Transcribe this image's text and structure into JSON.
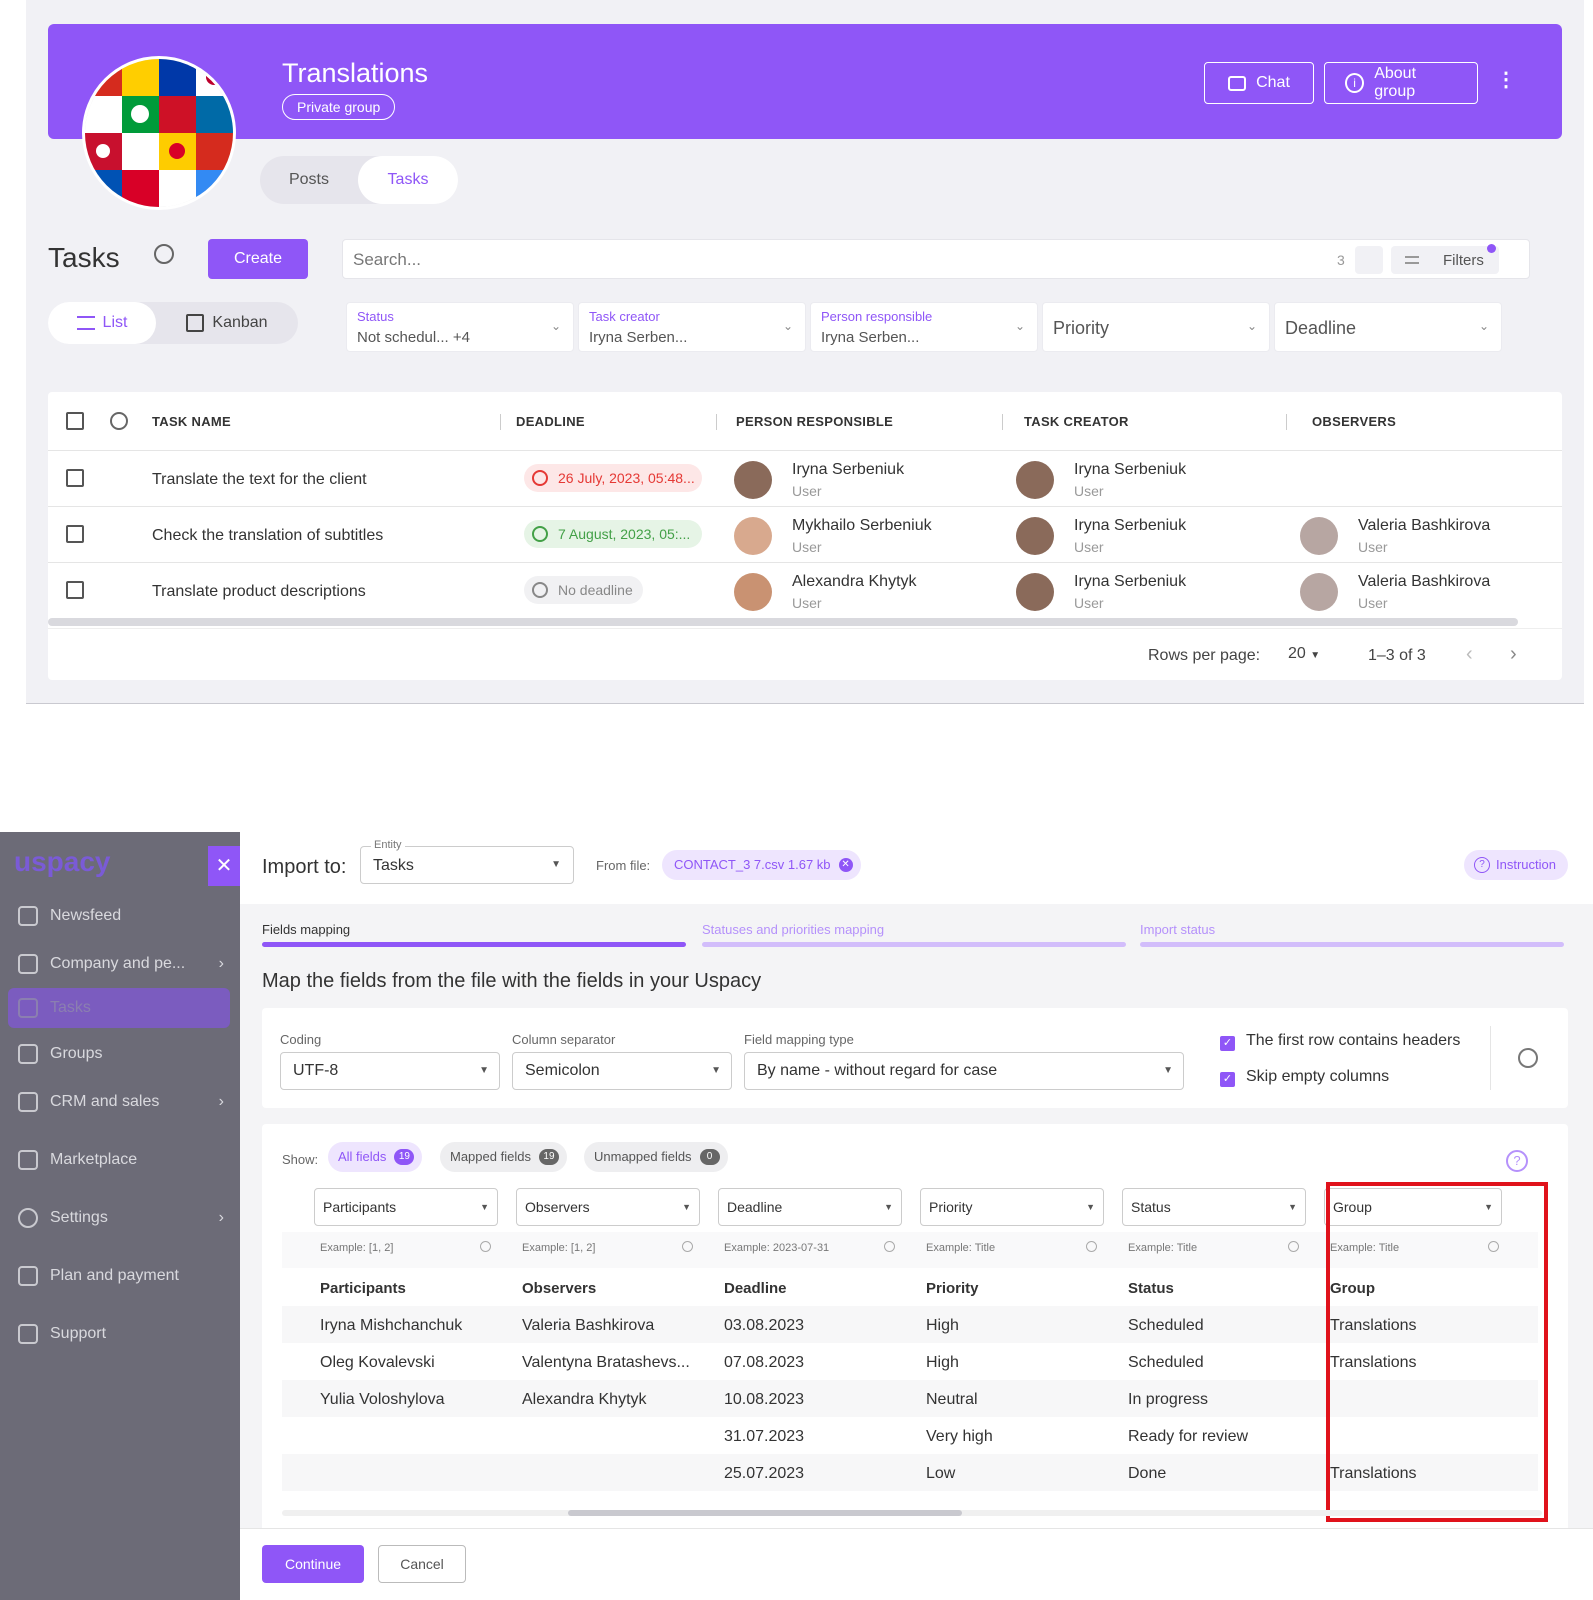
{
  "group": {
    "title": "Translations",
    "badge": "Private group",
    "chat_label": "Chat",
    "about_label": "About group",
    "tabs": [
      {
        "label": "Posts"
      },
      {
        "label": "Tasks"
      }
    ]
  },
  "toolbar": {
    "title": "Tasks",
    "create_label": "Create",
    "search_placeholder": "Search...",
    "search_count": "3",
    "filters_label": "Filters",
    "views": [
      {
        "label": "List"
      },
      {
        "label": "Kanban"
      }
    ]
  },
  "filters": [
    {
      "label": "Status",
      "value": "Not schedul... +4"
    },
    {
      "label": "Task creator",
      "value": "Iryna Serben..."
    },
    {
      "label": "Person responsible",
      "value": "Iryna Serben..."
    },
    {
      "label": "",
      "value": "Priority"
    },
    {
      "label": "",
      "value": "Deadline"
    }
  ],
  "tasks_table": {
    "headers": [
      "TASK NAME",
      "DEADLINE",
      "PERSON RESPONSIBLE",
      "TASK CREATOR",
      "OBSERVERS"
    ],
    "rows": [
      {
        "name": "Translate the text for the client",
        "deadline": "26 July, 2023, 05:48...",
        "deadline_state": "overdue",
        "responsible": "Iryna Serbeniuk",
        "responsible_role": "User",
        "creator": "Iryna Serbeniuk",
        "creator_role": "User",
        "observer": "",
        "observer_role": ""
      },
      {
        "name": "Check the translation of subtitles",
        "deadline": "7 August, 2023, 05:...",
        "deadline_state": "ok",
        "responsible": "Mykhailo Serbeniuk",
        "responsible_role": "User",
        "creator": "Iryna Serbeniuk",
        "creator_role": "User",
        "observer": "Valeria Bashkirova",
        "observer_role": "User"
      },
      {
        "name": "Translate product descriptions",
        "deadline": "No deadline",
        "deadline_state": "none",
        "responsible": "Alexandra Khytyk",
        "responsible_role": "User",
        "creator": "Iryna Serbeniuk",
        "creator_role": "User",
        "observer": "Valeria Bashkirova",
        "observer_role": "User"
      }
    ],
    "pagination": {
      "rows_label": "Rows per page:",
      "rows_value": "20",
      "range": "1–3 of 3"
    }
  },
  "colors": {
    "accent": "#8f56f7",
    "overdue": "#e53935",
    "ok": "#43a047",
    "highlight": "#e0121b"
  },
  "sidebar": {
    "logo": "uspacy",
    "items": [
      {
        "label": "Newsfeed",
        "has_children": false
      },
      {
        "label": "Company and pe...",
        "has_children": true
      },
      {
        "label": "Tasks",
        "has_children": false
      },
      {
        "label": "Groups",
        "has_children": false
      },
      {
        "label": "CRM and sales",
        "has_children": true
      },
      {
        "label": "Marketplace",
        "has_children": false
      },
      {
        "label": "Settings",
        "has_children": true
      },
      {
        "label": "Plan and payment",
        "has_children": false
      },
      {
        "label": "Support",
        "has_children": false
      }
    ]
  },
  "import": {
    "title": "Import to:",
    "entity_label": "Entity",
    "entity_value": "Tasks",
    "from_file_label": "From file:",
    "file_name": "CONTACT_3 7.csv 1.67 kb",
    "instruction_label": "Instruction",
    "steps": [
      {
        "label": "Fields mapping"
      },
      {
        "label": "Statuses and priorities mapping"
      },
      {
        "label": "Import status"
      }
    ],
    "heading": "Map the fields from the file with the fields in your Uspacy",
    "coding_label": "Coding",
    "coding_value": "UTF-8",
    "separator_label": "Column separator",
    "separator_value": "Semicolon",
    "mapping_type_label": "Field mapping type",
    "mapping_type_value": "By name - without regard for case",
    "headers_checkbox": "The first row contains headers",
    "skip_checkbox": "Skip empty columns",
    "show_label": "Show:",
    "chips": [
      {
        "label": "All fields",
        "count": "19"
      },
      {
        "label": "Mapped fields",
        "count": "19"
      },
      {
        "label": "Unmapped fields",
        "count": "0"
      }
    ],
    "columns": [
      {
        "field": "Participants",
        "example": "Example: [1, 2]",
        "header": "Participants",
        "values": [
          "Iryna Mishchanchuk",
          "Oleg Kovalevski",
          "Yulia Voloshylova",
          "",
          ""
        ]
      },
      {
        "field": "Observers",
        "example": "Example: [1, 2]",
        "header": "Observers",
        "values": [
          "Valeria Bashkirova",
          "Valentyna Bratashevs...",
          "Alexandra Khytyk",
          "",
          ""
        ]
      },
      {
        "field": "Deadline",
        "example": "Example: 2023-07-31",
        "header": "Deadline",
        "values": [
          "03.08.2023",
          "07.08.2023",
          "10.08.2023",
          "31.07.2023",
          "25.07.2023"
        ]
      },
      {
        "field": "Priority",
        "example": "Example: Title",
        "header": "Priority",
        "values": [
          "High",
          "High",
          "Neutral",
          "Very high",
          "Low"
        ]
      },
      {
        "field": "Status",
        "example": "Example: Title",
        "header": "Status",
        "values": [
          "Scheduled",
          "Scheduled",
          "In progress",
          "Ready for review",
          "Done"
        ]
      },
      {
        "field": "Group",
        "example": "Example: Title",
        "header": "Group",
        "values": [
          "Translations",
          "Translations",
          "",
          "",
          "Translations"
        ]
      }
    ],
    "continue_label": "Continue",
    "cancel_label": "Cancel"
  }
}
